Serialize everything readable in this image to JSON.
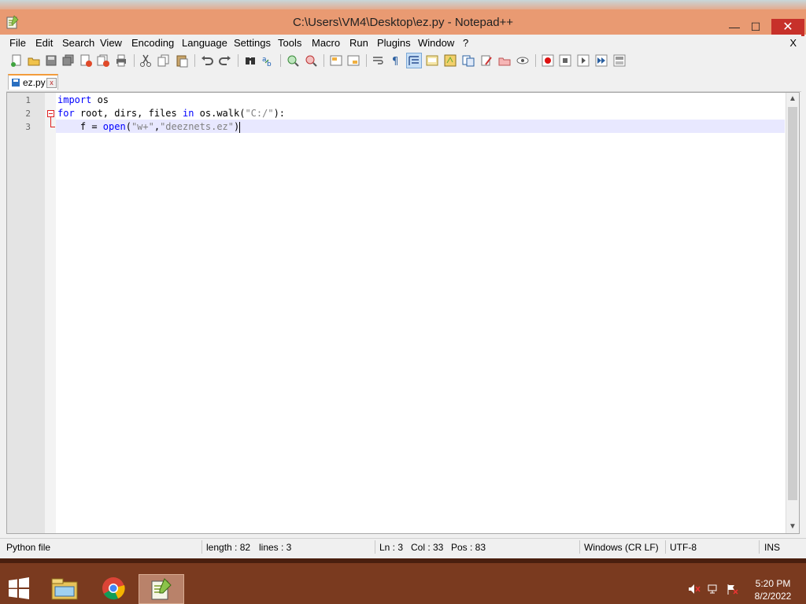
{
  "window": {
    "title": "C:\\Users\\VM4\\Desktop\\ez.py - Notepad++",
    "min_label": "—",
    "max_label": "☐",
    "close_label": "✕"
  },
  "menu": {
    "items": [
      "File",
      "Edit",
      "Search",
      "View",
      "Encoding",
      "Language",
      "Settings",
      "Tools",
      "Macro",
      "Run",
      "Plugins",
      "Window",
      "?"
    ],
    "close_label": "X"
  },
  "tabs": [
    {
      "label": "ez.py",
      "close_label": "x"
    }
  ],
  "editor": {
    "line_numbers": [
      "1",
      "2",
      "3"
    ],
    "lines": [
      [
        {
          "t": "import",
          "c": "kw"
        },
        {
          "t": " os",
          "c": ""
        }
      ],
      [
        {
          "t": "for",
          "c": "kw"
        },
        {
          "t": " root, dirs, files ",
          "c": ""
        },
        {
          "t": "in",
          "c": "kw"
        },
        {
          "t": " os.walk(",
          "c": ""
        },
        {
          "t": "\"C:/\"",
          "c": "str"
        },
        {
          "t": "):",
          "c": ""
        }
      ],
      [
        {
          "t": "    f = ",
          "c": ""
        },
        {
          "t": "open",
          "c": "fn"
        },
        {
          "t": "(",
          "c": ""
        },
        {
          "t": "\"w+\"",
          "c": "str"
        },
        {
          "t": ",",
          "c": ""
        },
        {
          "t": "\"deeznets.ez\"",
          "c": "str"
        },
        {
          "t": ")",
          "c": ""
        }
      ]
    ]
  },
  "status": {
    "file_type": "Python file",
    "length": "length : 82",
    "lines": "lines : 3",
    "ln": "Ln : 3",
    "col": "Col : 33",
    "pos": "Pos : 83",
    "eol": "Windows (CR LF)",
    "encoding": "UTF-8",
    "mode": "INS"
  },
  "taskbar": {
    "time": "5:20 PM",
    "date": "8/2/2022"
  },
  "colors": {
    "accent": "#e99a72",
    "keyword": "#0000ff",
    "string": "#808080",
    "current_line": "#e8e8ff",
    "tab_accent": "#f39c3b"
  }
}
